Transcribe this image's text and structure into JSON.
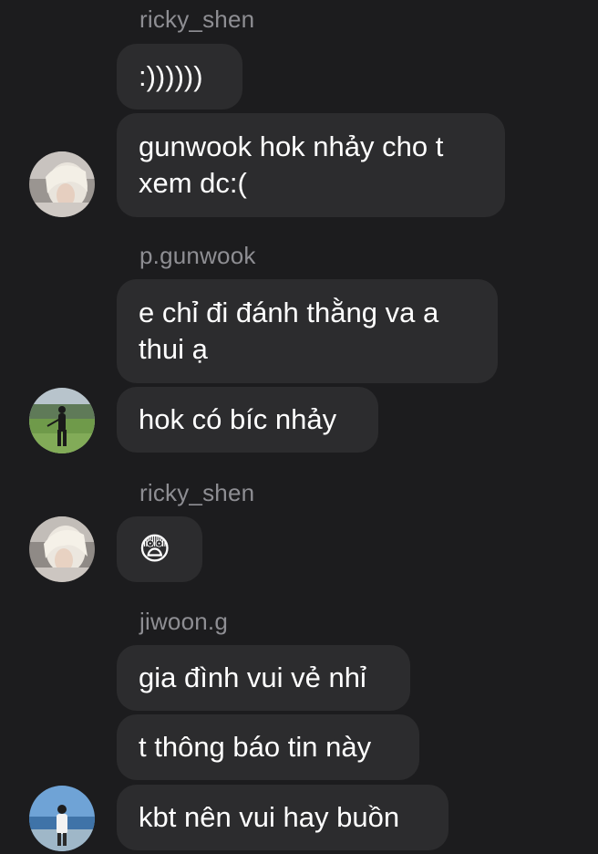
{
  "messages": {
    "g1": {
      "sender": "ricky_shen",
      "m1": ":))))))",
      "m2": "gunwook hok nhảy cho t xem dc:("
    },
    "g2": {
      "sender": "p.gunwook",
      "m1": "e chỉ đi đánh thằng va a thui ạ",
      "m2": "hok có bíc nhảy"
    },
    "g3": {
      "sender": "ricky_shen",
      "m1": "😨"
    },
    "g4": {
      "sender": "jiwoon.g",
      "m1": "gia đình vui vẻ nhỉ",
      "m2": "t thông báo tin này",
      "m3": "kbt nên vui hay buồn"
    }
  },
  "colors": {
    "background": "#1c1c1e",
    "bubble": "#2c2c2e",
    "sender_text": "#8e8e93",
    "message_text": "#ffffff"
  },
  "avatars": {
    "ricky_shen": "avatar-blond-hair",
    "p_gunwook": "avatar-golf-field",
    "jiwoon_g": "avatar-sea-sky"
  }
}
